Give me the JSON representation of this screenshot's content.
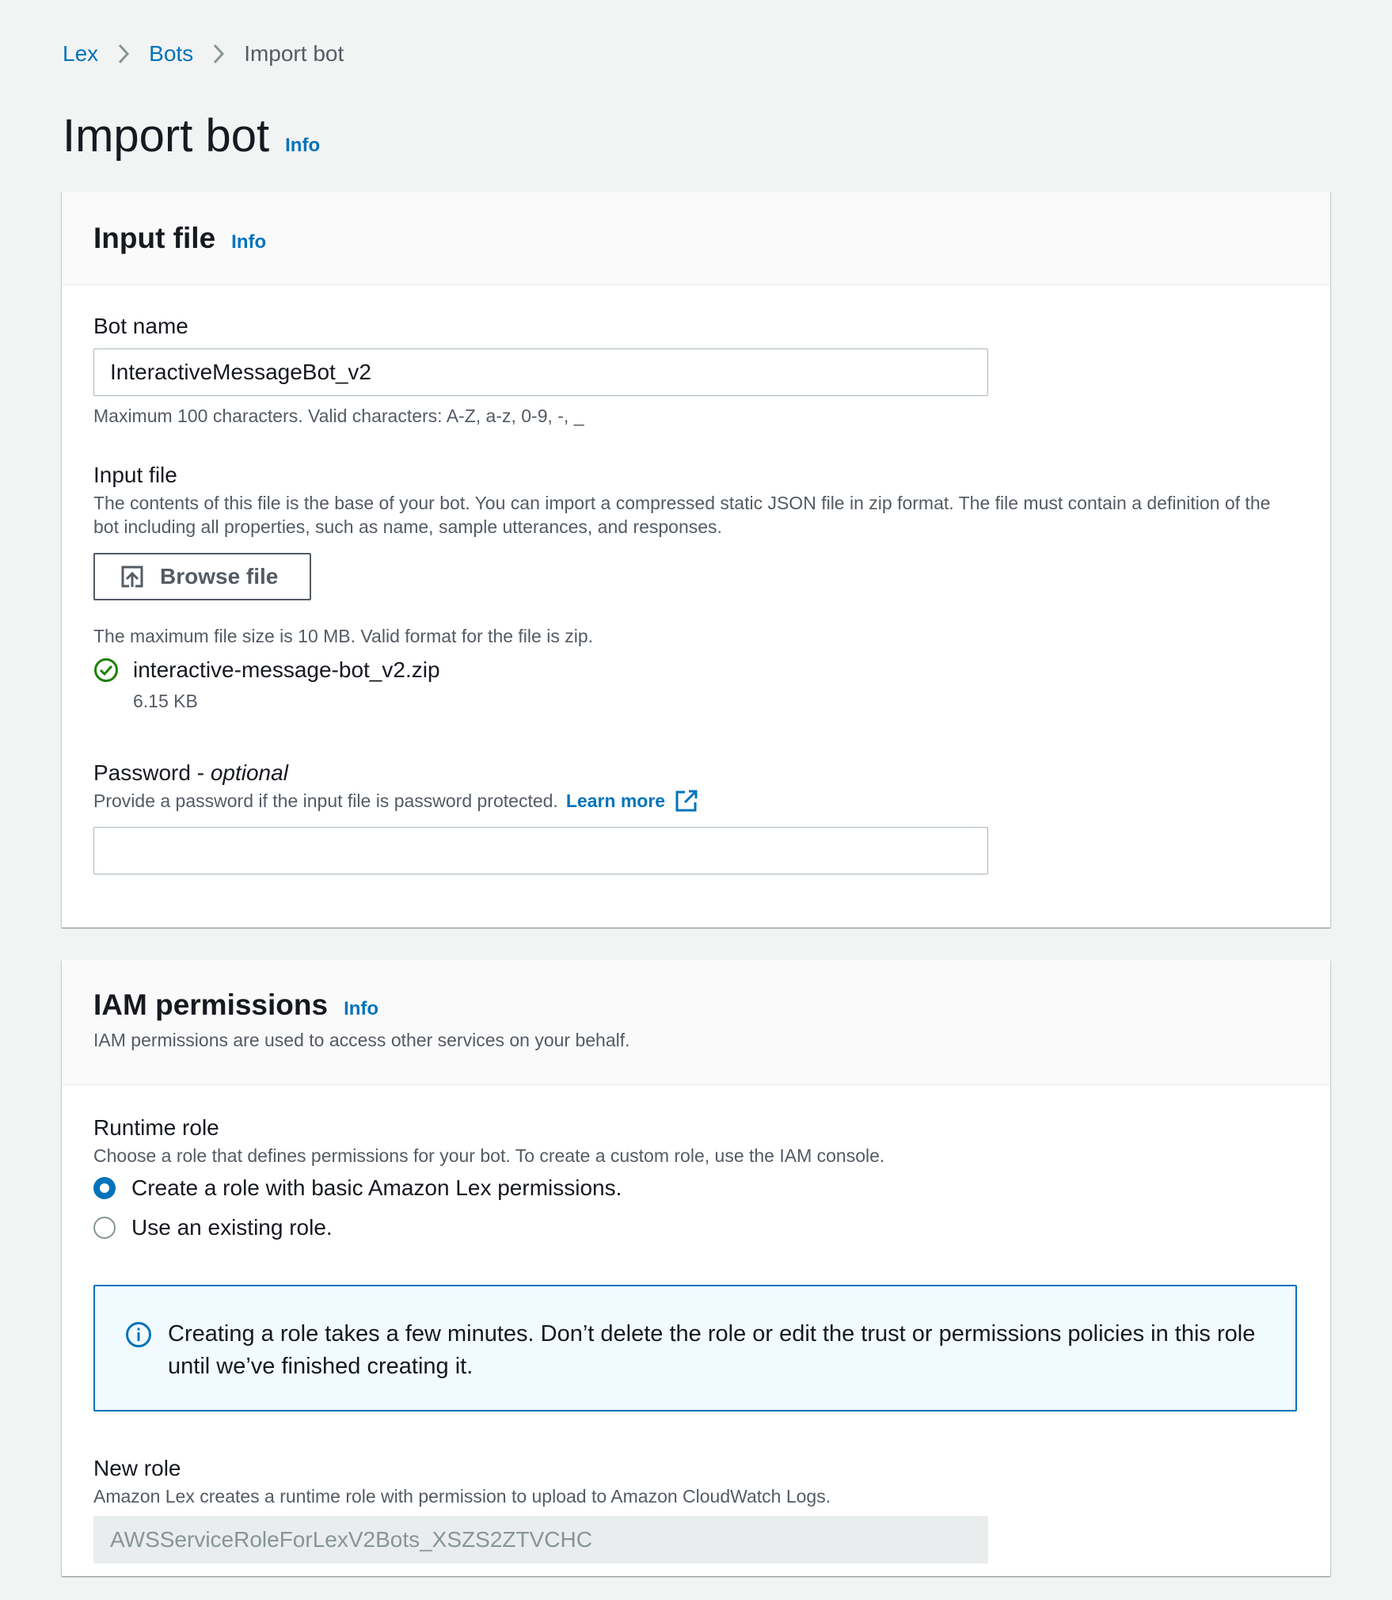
{
  "breadcrumb": {
    "items": [
      {
        "label": "Lex"
      },
      {
        "label": "Bots"
      },
      {
        "label": "Import bot"
      }
    ]
  },
  "page": {
    "title": "Import bot",
    "info": "Info"
  },
  "input_file_panel": {
    "title": "Input file",
    "info": "Info",
    "bot_name": {
      "label": "Bot name",
      "value": "InteractiveMessageBot_v2",
      "hint": "Maximum 100 characters. Valid characters: A-Z, a-z, 0-9, -, _"
    },
    "input_file": {
      "label": "Input file",
      "description": "The contents of this file is the base of your bot. You can import a compressed static JSON file in zip format. The file must contain a definition of the bot including all properties, such as name, sample utterances, and responses.",
      "browse_label": "Browse file",
      "hint": "The maximum file size is 10 MB. Valid format for the file is zip.",
      "file_name": "interactive-message-bot_v2.zip",
      "file_size": "6.15 KB"
    },
    "password": {
      "label": "Password - ",
      "optional": "optional",
      "description": "Provide a password if the input file is password protected.",
      "learn_more": "Learn more",
      "value": ""
    }
  },
  "iam_panel": {
    "title": "IAM permissions",
    "info": "Info",
    "description": "IAM permissions are used to access other services on your behalf.",
    "runtime_role": {
      "label": "Runtime role",
      "description": "Choose a role that defines permissions for your bot. To create a custom role, use the IAM console.",
      "options": [
        {
          "label": "Create a role with basic Amazon Lex permissions.",
          "selected": true
        },
        {
          "label": "Use an existing role.",
          "selected": false
        }
      ]
    },
    "alert": "Creating a role takes a few minutes. Don’t delete the role or edit the trust or permissions policies in this role until we’ve finished creating it.",
    "new_role": {
      "label": "New role",
      "description": "Amazon Lex creates a runtime role with permission to upload to Amazon CloudWatch Logs.",
      "value": "AWSServiceRoleForLexV2Bots_XSZS2ZTVCHC"
    }
  },
  "colors": {
    "link": "#0073bb",
    "success": "#1d8102",
    "background": "#f2f3f3"
  }
}
